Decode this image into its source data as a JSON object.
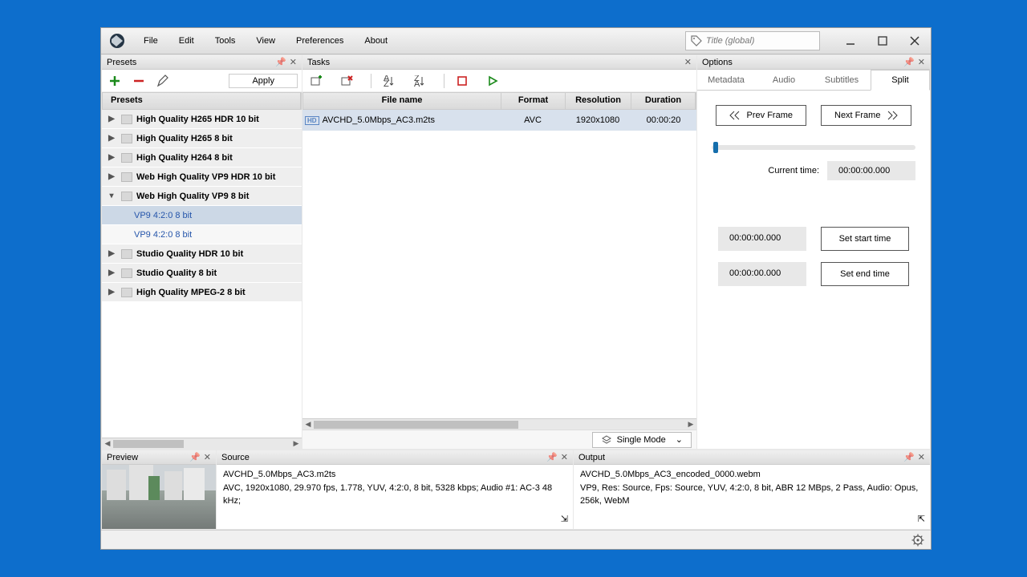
{
  "menu": {
    "file": "File",
    "edit": "Edit",
    "tools": "Tools",
    "view": "View",
    "preferences": "Preferences",
    "about": "About"
  },
  "search": {
    "placeholder": "Title (global)"
  },
  "panels": {
    "presets": "Presets",
    "tasks": "Tasks",
    "options": "Options",
    "preview": "Preview",
    "source": "Source",
    "output": "Output"
  },
  "presets": {
    "apply": "Apply",
    "header": "Presets",
    "items": [
      "High Quality H265 HDR 10 bit",
      "High Quality H265 8 bit",
      "High Quality H264 8 bit",
      "Web High Quality VP9 HDR 10 bit",
      "Web High Quality VP9 8 bit",
      "Studio Quality HDR 10 bit",
      "Studio Quality 8 bit",
      "High Quality MPEG-2 8 bit"
    ],
    "sub1": "VP9 4:2:0 8 bit",
    "sub2": "VP9 4:2:0 8 bit"
  },
  "tasks": {
    "columns": {
      "file": "File name",
      "format": "Format",
      "resolution": "Resolution",
      "duration": "Duration"
    },
    "row": {
      "file": "AVCHD_5.0Mbps_AC3.m2ts",
      "format": "AVC",
      "resolution": "1920x1080",
      "duration": "00:00:20"
    },
    "singlemode": "Single Mode"
  },
  "options": {
    "tabs": {
      "metadata": "Metadata",
      "audio": "Audio",
      "subtitles": "Subtitles",
      "split": "Split"
    },
    "prev": "Prev Frame",
    "next": "Next Frame",
    "curtime_label": "Current time:",
    "curtime_value": "00:00:00.000",
    "start_value": "00:00:00.000",
    "start_btn": "Set start time",
    "end_value": "00:00:00.000",
    "end_btn": "Set end time"
  },
  "source": {
    "file": "AVCHD_5.0Mbps_AC3.m2ts",
    "info": "AVC, 1920x1080, 29.970 fps, 1.778, YUV, 4:2:0, 8 bit, 5328 kbps; Audio #1: AC-3  48 kHz;"
  },
  "output": {
    "file": "AVCHD_5.0Mbps_AC3_encoded_0000.webm",
    "info": "VP9, Res: Source, Fps: Source, YUV, 4:2:0, 8  bit, ABR 12 MBps, 2 Pass, Audio: Opus, 256k, WebM"
  }
}
